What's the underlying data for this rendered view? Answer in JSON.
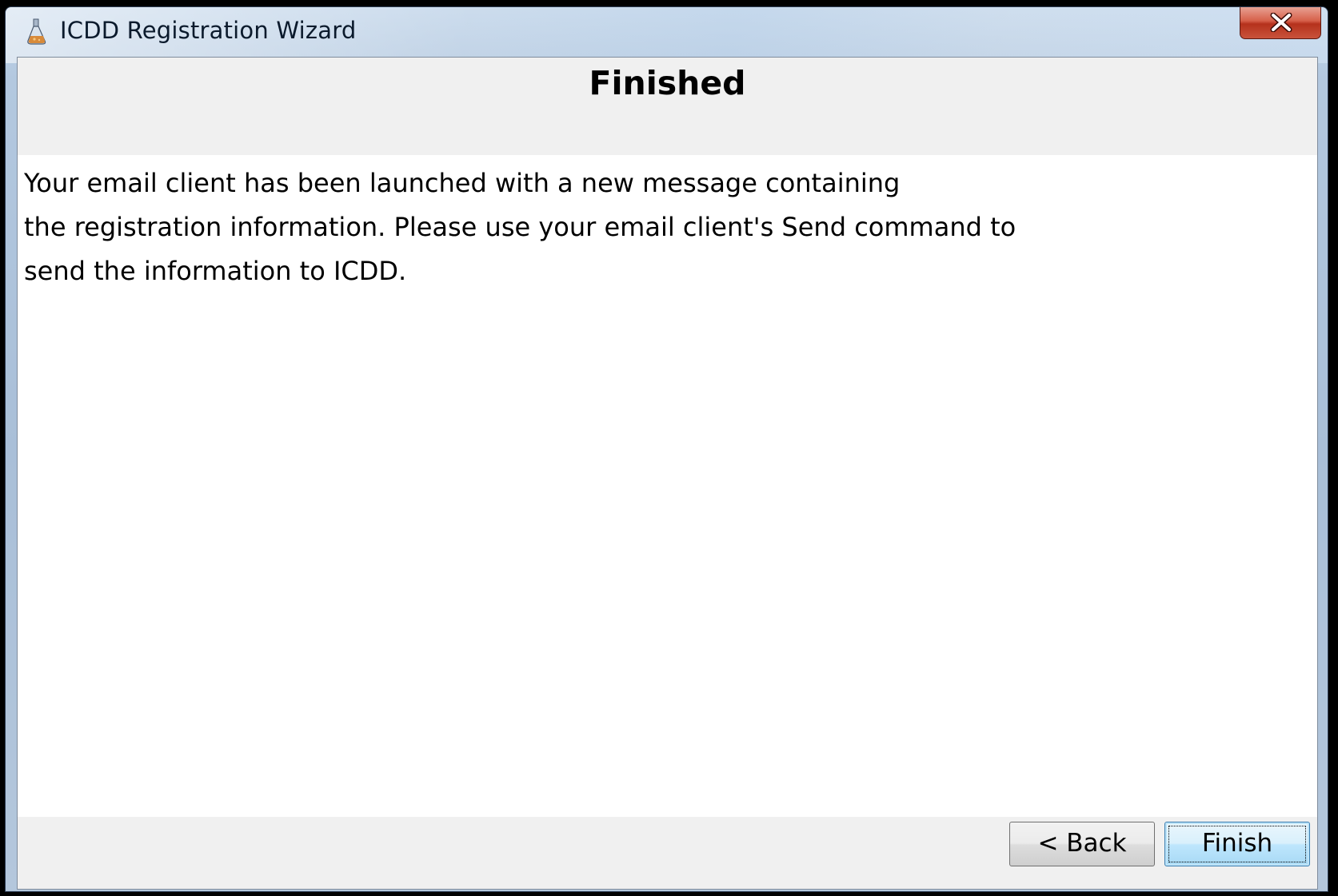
{
  "window": {
    "title": "ICDD Registration Wizard",
    "app_icon": "flask-icon",
    "close_icon": "close-icon"
  },
  "header": {
    "title": "Finished"
  },
  "main": {
    "message_lines": [
      "Your email client has been launched with a new message containing",
      "the registration information. Please use your email client's Send command to",
      "send the information to ICDD."
    ]
  },
  "footer": {
    "back_label": "< Back",
    "finish_label": "Finish"
  },
  "colors": {
    "close_button": "#c9533b",
    "finish_button": "#bee6fd",
    "panel_background": "#f0f0f0"
  }
}
